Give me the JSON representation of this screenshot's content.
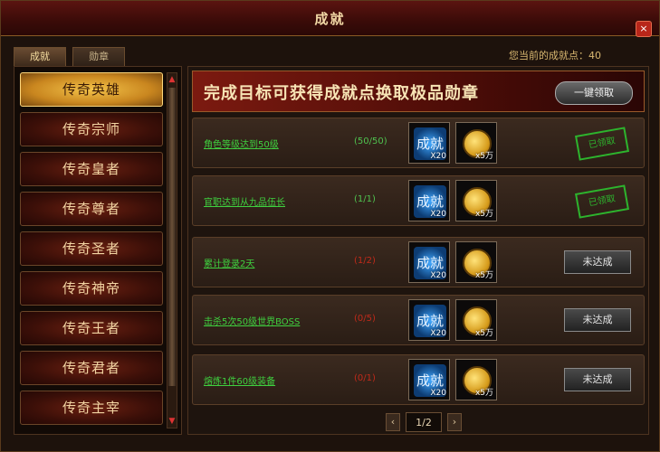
{
  "window": {
    "title": "成就",
    "close_label": "×"
  },
  "tabs": [
    {
      "label": "成就",
      "active": true
    },
    {
      "label": "勋章",
      "active": false
    }
  ],
  "points": {
    "label": "您当前的成就点：40"
  },
  "sidebar": {
    "items": [
      {
        "label": "传奇英雄",
        "active": true
      },
      {
        "label": "传奇宗师",
        "active": false
      },
      {
        "label": "传奇皇者",
        "active": false
      },
      {
        "label": "传奇尊者",
        "active": false
      },
      {
        "label": "传奇圣者",
        "active": false
      },
      {
        "label": "传奇神帝",
        "active": false
      },
      {
        "label": "传奇王者",
        "active": false
      },
      {
        "label": "传奇君者",
        "active": false
      },
      {
        "label": "传奇主宰",
        "active": false
      }
    ],
    "scroll_up": "▲",
    "scroll_down": "▼"
  },
  "banner": {
    "text": "完成目标可获得成就点换取极品勋章",
    "claim_all": "一键领取"
  },
  "rows": [
    {
      "task": "角色等级达到50级",
      "progress": "(50/50)",
      "done": true,
      "rewards": [
        {
          "icon": "成就",
          "qty": "X20"
        },
        {
          "icon": "coin",
          "qty": "x5万"
        }
      ],
      "action": "已领取",
      "action_type": "stamp"
    },
    {
      "task": "官职达到从九品伍长",
      "progress": "(1/1)",
      "done": true,
      "rewards": [
        {
          "icon": "成就",
          "qty": "X20"
        },
        {
          "icon": "coin",
          "qty": "x5万"
        }
      ],
      "action": "已领取",
      "action_type": "stamp"
    },
    {
      "task": "累计登录2天",
      "progress": "(1/2)",
      "done": false,
      "rewards": [
        {
          "icon": "成就",
          "qty": "X20"
        },
        {
          "icon": "coin",
          "qty": "x5万"
        }
      ],
      "action": "未达成",
      "action_type": "button"
    },
    {
      "task": "击杀5次50级世界BOSS",
      "progress": "(0/5)",
      "done": false,
      "rewards": [
        {
          "icon": "成就",
          "qty": "X20"
        },
        {
          "icon": "coin",
          "qty": "x5万"
        }
      ],
      "action": "未达成",
      "action_type": "button"
    },
    {
      "task": "熔炼1件60级装备",
      "progress": "(0/1)",
      "done": false,
      "rewards": [
        {
          "icon": "成就",
          "qty": "X20"
        },
        {
          "icon": "coin",
          "qty": "x5万"
        }
      ],
      "action": "未达成",
      "action_type": "button"
    }
  ],
  "pager": {
    "prev": "‹",
    "page": "1/2",
    "next": "›"
  }
}
